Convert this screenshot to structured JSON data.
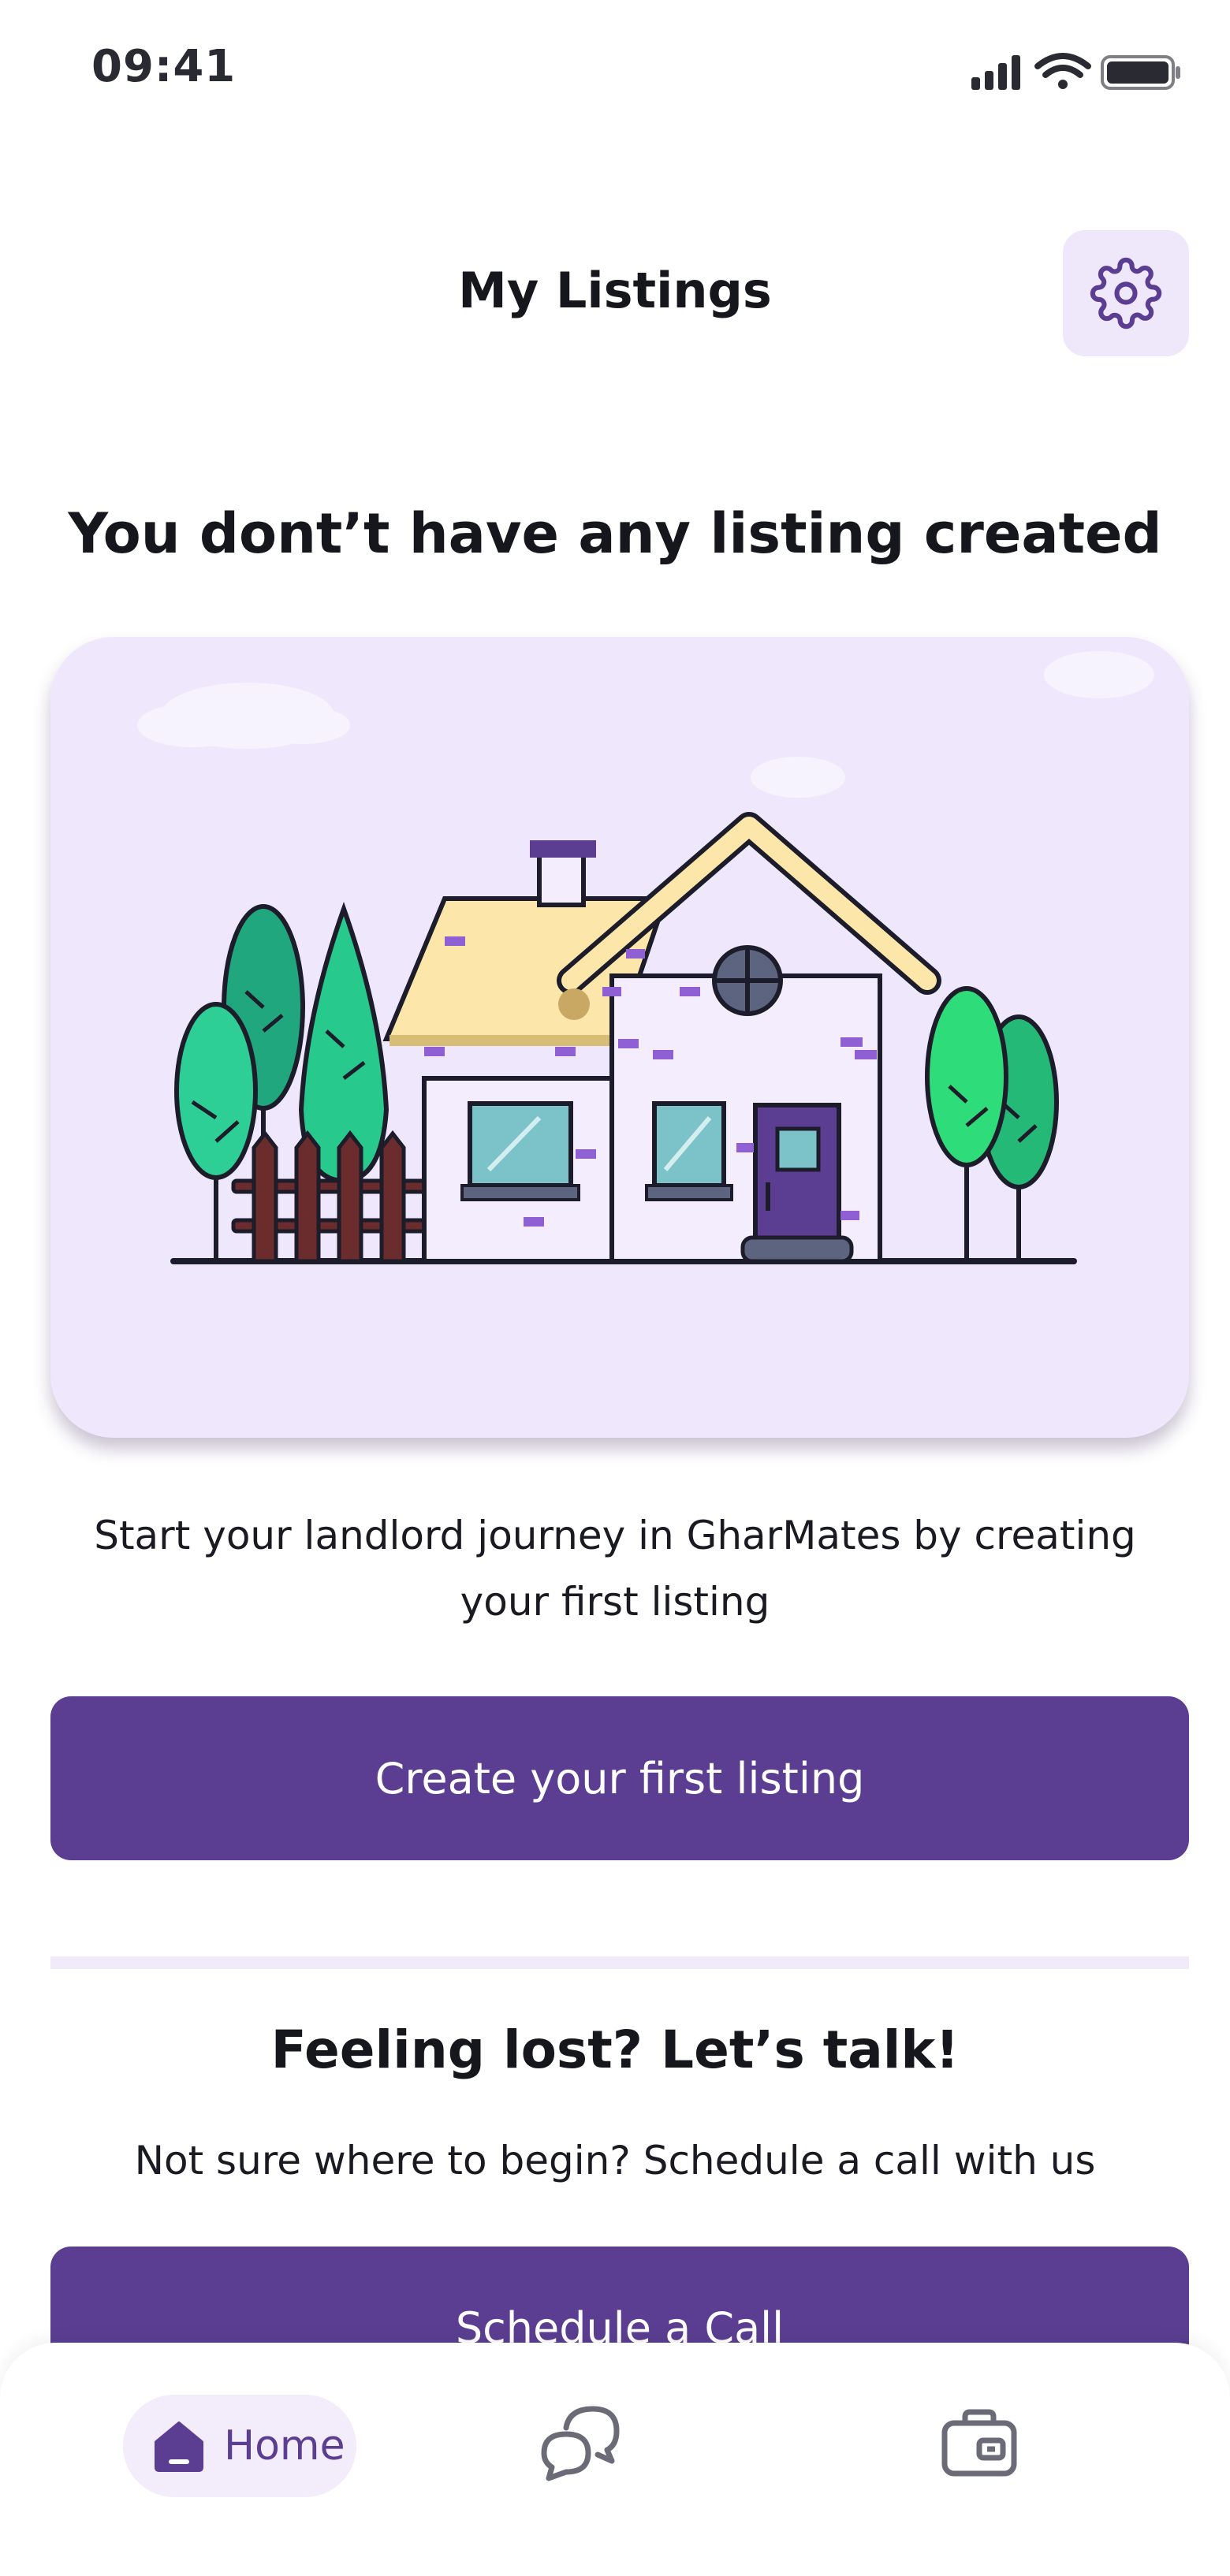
{
  "status_bar": {
    "time": "09:41",
    "icons": [
      "signal-icon",
      "wifi-icon",
      "battery-icon"
    ]
  },
  "header": {
    "title": "My Listings",
    "settings_icon": "gear-icon"
  },
  "empty_state": {
    "title": "You dont’t have any listing created",
    "illustration": "house-illustration",
    "description": "Start your landlord journey in GharMates by creating your first listing",
    "create_button": "Create your first listing"
  },
  "help": {
    "title": "Feeling lost? Let’s talk!",
    "subtitle": "Not sure where to begin? Schedule a call with us",
    "schedule_button": "Schedule a Call"
  },
  "bottom_nav": {
    "items": [
      {
        "label": "Home",
        "icon": "home-icon",
        "active": true
      },
      {
        "label": "",
        "icon": "chat-icon",
        "active": false
      },
      {
        "label": "",
        "icon": "wallet-icon",
        "active": false
      }
    ]
  },
  "colors": {
    "primary": "#5b3e91",
    "card_bg": "#efe8fd",
    "accent_light": "#efe8fb"
  }
}
